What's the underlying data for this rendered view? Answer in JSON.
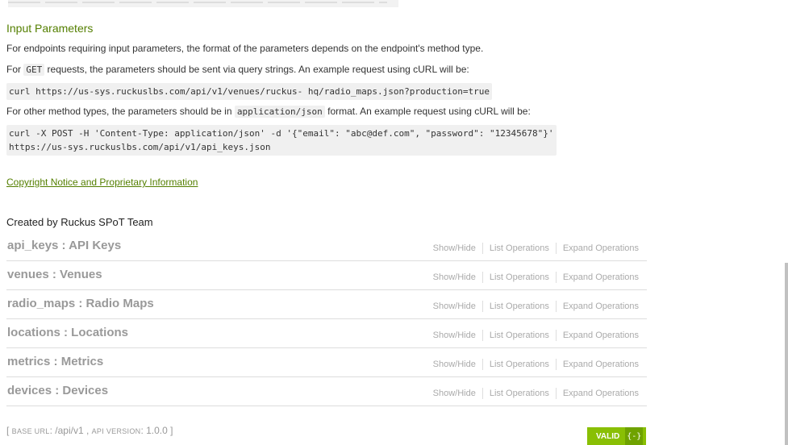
{
  "section": {
    "title": "Input Parameters",
    "intro": "For endpoints requiring input parameters, the format of the parameters depends on the endpoint's method type.",
    "get_prefix": "For ",
    "get_code": "GET",
    "get_suffix": " requests, the parameters should be sent via query strings. An example request using cURL will be:",
    "get_example": "curl https://us-sys.ruckuslbs.com/api/v1/venues/ruckus- hq/radio_maps.json?production=true",
    "other_prefix": "For other method types, the parameters should be in ",
    "other_code": "application/json",
    "other_suffix": " format. An example request using cURL will be:",
    "post_example": "curl -X POST -H 'Content-Type: application/json' -d '{\"email\": \"abc@def.com\", \"password\": \"12345678\"}'\nhttps://us-sys.ruckuslbs.com/api/v1/api_keys.json"
  },
  "copyright_link": "Copyright Notice and Proprietary Information",
  "created_by": "Created by Ruckus SPoT Team",
  "resources": [
    {
      "name": "api_keys : API Keys"
    },
    {
      "name": "venues : Venues"
    },
    {
      "name": "radio_maps : Radio Maps"
    },
    {
      "name": "locations : Locations"
    },
    {
      "name": "metrics : Metrics"
    },
    {
      "name": "devices : Devices"
    }
  ],
  "ops": {
    "show_hide": "Show/Hide",
    "list": "List Operations",
    "expand": "Expand Operations"
  },
  "footer": {
    "open": "[ ",
    "base_url_label": "Base URL",
    "base_url_value": ": /api/v1 , ",
    "api_version_label": "API version",
    "api_version_value": ": 1.0.0 ]"
  },
  "validator": {
    "label": "VALID",
    "icon": "{-}"
  }
}
